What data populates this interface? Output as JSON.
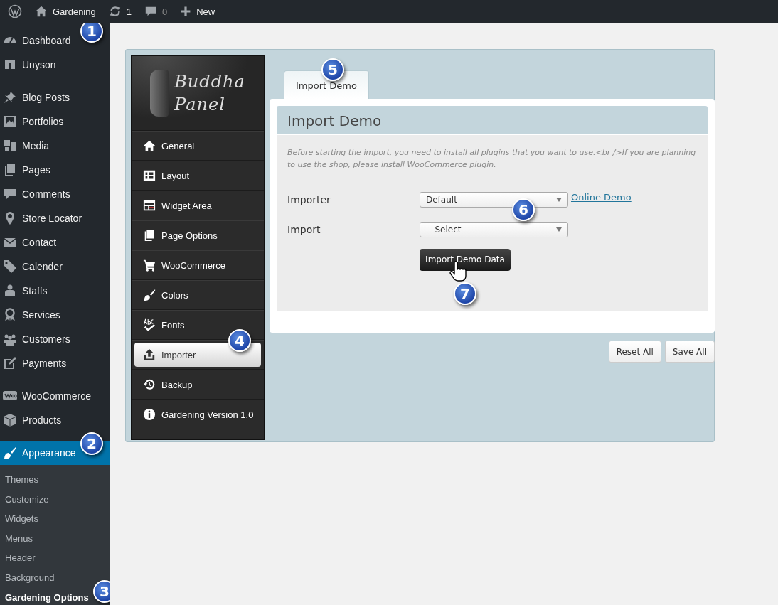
{
  "admin_bar": [
    {
      "kind": "wordpress"
    },
    {
      "kind": "home",
      "label": "Gardening"
    },
    {
      "kind": "updates",
      "label": "1"
    },
    {
      "kind": "comments",
      "label": "0"
    },
    {
      "kind": "new",
      "label": "New"
    }
  ],
  "admin_menu": {
    "groups": [
      [
        {
          "kind": "dashboard",
          "label": "Dashboard",
          "selected": false,
          "callout": "1"
        },
        {
          "kind": "unyson",
          "label": "Unyson",
          "selected": false
        }
      ],
      [
        {
          "kind": "pin",
          "label": "Blog Posts",
          "selected": false
        },
        {
          "kind": "portfolio",
          "label": "Portfolios",
          "selected": false
        },
        {
          "kind": "media",
          "label": "Media",
          "selected": false
        },
        {
          "kind": "pages",
          "label": "Pages",
          "selected": false
        },
        {
          "kind": "comments",
          "label": "Comments",
          "selected": false
        },
        {
          "kind": "location",
          "label": "Store Locator",
          "selected": false
        },
        {
          "kind": "mail",
          "label": "Contact",
          "selected": false
        },
        {
          "kind": "tag",
          "label": "Calender",
          "selected": false
        },
        {
          "kind": "person",
          "label": "Staffs",
          "selected": false
        },
        {
          "kind": "award",
          "label": "Services",
          "selected": false
        },
        {
          "kind": "group",
          "label": "Customers",
          "selected": false
        },
        {
          "kind": "edit",
          "label": "Payments",
          "selected": false
        }
      ],
      [
        {
          "kind": "woo",
          "label": "WooCommerce",
          "selected": false
        },
        {
          "kind": "box",
          "label": "Products",
          "selected": false
        }
      ],
      [
        {
          "kind": "brush",
          "label": "Appearance",
          "selected": true,
          "callout": "2",
          "children": [
            {
              "label": "Themes",
              "selected": false
            },
            {
              "label": "Customize",
              "selected": false
            },
            {
              "label": "Widgets",
              "selected": false
            },
            {
              "label": "Menus",
              "selected": false
            },
            {
              "label": "Header",
              "selected": false
            },
            {
              "label": "Background",
              "selected": false
            },
            {
              "label": "Gardening Options",
              "selected": true,
              "callout": "3"
            }
          ]
        }
      ]
    ]
  },
  "panel": {
    "logo": [
      "Buddha",
      "Panel"
    ],
    "nav": [
      {
        "kind": "home",
        "label": "General",
        "selected": false
      },
      {
        "kind": "layout",
        "label": "Layout",
        "selected": false
      },
      {
        "kind": "widgets",
        "label": "Widget Area",
        "selected": false
      },
      {
        "kind": "pages",
        "label": "Page Options",
        "selected": false
      },
      {
        "kind": "cart",
        "label": "WooCommerce",
        "selected": false
      },
      {
        "kind": "brush",
        "label": "Colors",
        "selected": false
      },
      {
        "kind": "fonts",
        "label": "Fonts",
        "selected": false
      },
      {
        "kind": "upload",
        "label": "Importer",
        "selected": true,
        "callout": "4"
      },
      {
        "kind": "history",
        "label": "Backup",
        "selected": false
      },
      {
        "kind": "info",
        "label": "Gardening Version 1.0",
        "selected": false
      }
    ],
    "tabs": [
      {
        "label": "Import Demo",
        "selected": true,
        "callout": "5"
      }
    ],
    "section": {
      "title": "Import Demo",
      "description": "Before starting the import, you need to install all plugins that you want to use.<br />If you are planning to use the shop, please install WooCommerce plugin.",
      "fields": [
        {
          "label": "Importer",
          "value": "Default",
          "link": "Online Demo",
          "callout": "6"
        },
        {
          "label": "Import",
          "value": "-- Select --"
        }
      ],
      "button": {
        "label": "Import Demo Data",
        "callout": "7"
      }
    },
    "footer_buttons": [
      "Reset All",
      "Save All"
    ]
  }
}
